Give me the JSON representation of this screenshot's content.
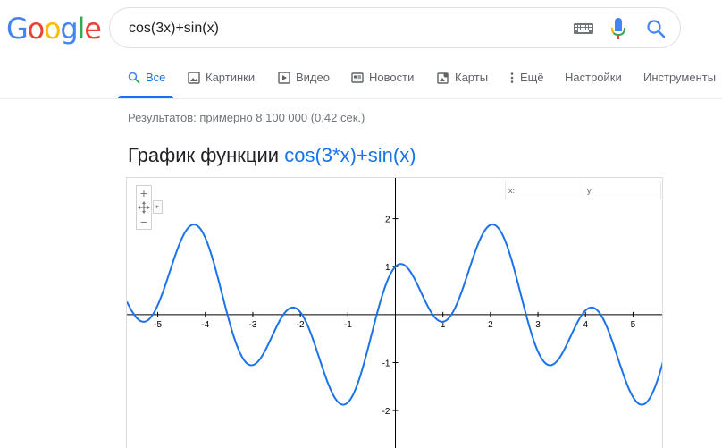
{
  "logo": {
    "letters": [
      "G",
      "o",
      "o",
      "g",
      "l",
      "e"
    ],
    "colors": [
      "#4285f4",
      "#ea4335",
      "#fbbc05",
      "#4285f4",
      "#34a853",
      "#ea4335"
    ]
  },
  "search": {
    "query": "cos(3x)+sin(x)"
  },
  "tabs": [
    {
      "label": "Все",
      "icon": "search-icon",
      "active": true
    },
    {
      "label": "Картинки",
      "icon": "image-icon"
    },
    {
      "label": "Видео",
      "icon": "video-icon"
    },
    {
      "label": "Новости",
      "icon": "news-icon"
    },
    {
      "label": "Карты",
      "icon": "map-icon"
    },
    {
      "label": "Ещё",
      "icon": "more-icon"
    },
    {
      "label": "Настройки"
    },
    {
      "label": "Инструменты"
    }
  ],
  "results": {
    "info": "Результатов: примерно 8 100 000 (0,42 сек.)"
  },
  "graph": {
    "title_prefix": "График функции",
    "function": "cos(3*x)+sin(x)",
    "coord_x_label": "x:",
    "coord_y_label": "y:"
  },
  "chart_data": {
    "type": "line",
    "function": "cos(3*x)+sin(x)",
    "xlim": [
      -5.65,
      5.65
    ],
    "ylim": [
      -2.8,
      2.85
    ],
    "x_ticks": [
      -5,
      -4,
      -3,
      -2,
      -1,
      1,
      2,
      3,
      4,
      5
    ],
    "y_ticks": [
      -2,
      -1,
      1,
      2
    ],
    "grid": false,
    "line_color": "#1a73e8"
  },
  "colors": {
    "accent": "#1a73e8",
    "muted": "#5f6368"
  }
}
